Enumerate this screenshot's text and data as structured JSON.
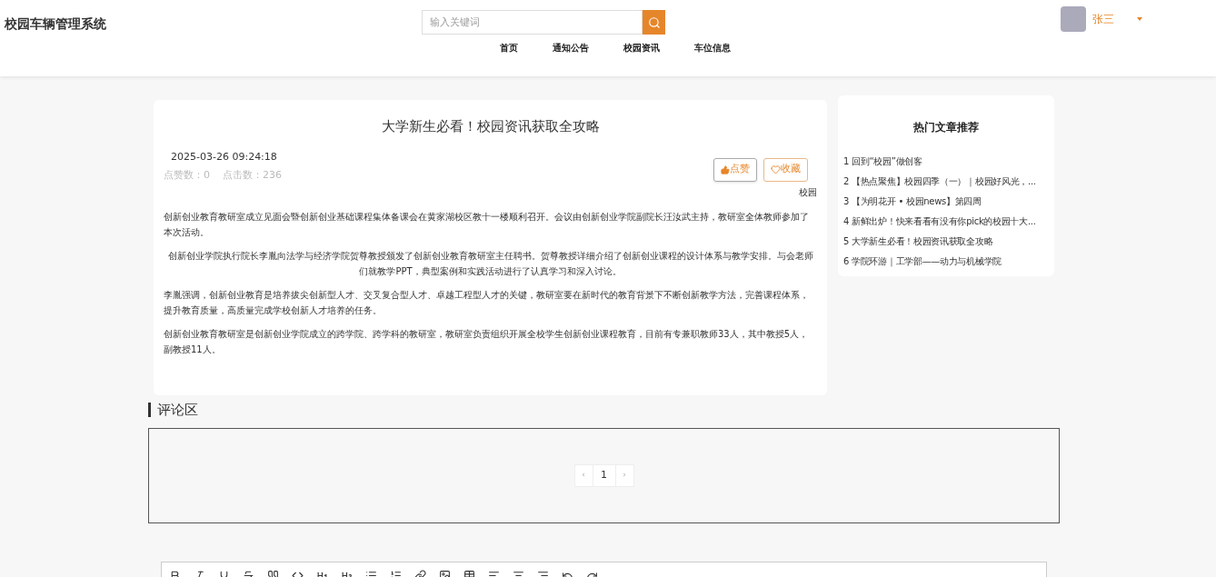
{
  "header": {
    "site_title": "校园车辆管理系统",
    "search": {
      "placeholder": "输入关键词"
    },
    "user": {
      "name": "张三"
    },
    "nav": [
      {
        "label": "首页"
      },
      {
        "label": "通知公告"
      },
      {
        "label": "校园资讯"
      },
      {
        "label": "车位信息"
      }
    ]
  },
  "article": {
    "title": "大学新生必看！校园资讯获取全攻略",
    "time": "2025-03-26 09:24:18",
    "stats": "点赞数：0    点击数：236",
    "like_button": "点赞",
    "collect_button": "收藏",
    "category": "校园",
    "paragraphs": [
      {
        "text": "创新创业教育教研室成立见面会暨创新创业基础课程集体备课会在黄家湖校区教十一楼顺利召开。会议由创新创业学院副院长汪汝武主持，教研室全体教师参加了本次活动。",
        "centered": false
      },
      {
        "text": "创新创业学院执行院长李胤向法学与经济学院贺尊教授颁发了创新创业教育教研室主任聘书。贺尊教授详细介绍了创新创业课程的设计体系与教学安排。与会老师们就教学PPT，典型案例和实践活动进行了认真学习和深入讨论。",
        "centered": true
      },
      {
        "text": "李胤强调，创新创业教育是培养拔尖创新型人才、交叉复合型人才、卓越工程型人才的关键，教研室要在新时代的教育背景下不断创新教学方法，完善课程体系，提升教育质量，高质量完成学校创新人才培养的任务。",
        "centered": false
      },
      {
        "text": "创新创业教育教研室是创新创业学院成立的跨学院、跨学科的教研室，教研室负责组织开展全校学生创新创业课程教育，目前有专兼职教师33人，其中教授5人，副教授11人。",
        "centered": false
      }
    ]
  },
  "hot_articles": {
    "title": "热门文章推荐",
    "items": [
      {
        "index": "1",
        "title": "回到“校园”做创客"
      },
      {
        "index": "2",
        "title": "【热点聚焦】校园四季（一）｜校园好风光，..."
      },
      {
        "index": "3",
        "title": "【为明花开 • 校园news】第四周"
      },
      {
        "index": "4",
        "title": "新鲜出炉！快来看看有没有你pick的校园十大..."
      },
      {
        "index": "5",
        "title": "大学新生必看！校园资讯获取全攻略"
      },
      {
        "index": "6",
        "title": "学院环游｜工学部——动力与机械学院"
      }
    ]
  },
  "comments": {
    "title": "评论区",
    "pagination": {
      "prev": "‹",
      "pages": [
        {
          "label": "1",
          "selected": true
        }
      ],
      "next": "›"
    }
  }
}
